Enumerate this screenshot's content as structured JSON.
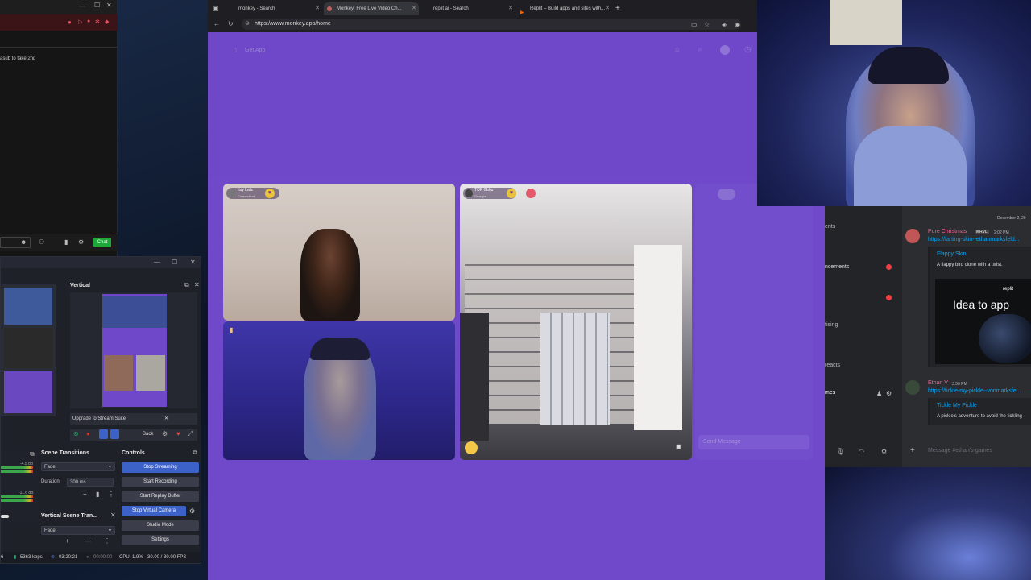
{
  "left_app": {
    "message": "asub to take 2nd",
    "chat_button": "Chat"
  },
  "obs": {
    "vertical_panel_title": "Vertical",
    "upgrade_label": "Upgrade to Stream Suite",
    "back_label": "Back",
    "scene_transitions": {
      "title": "Scene Transitions",
      "selected": "Fade",
      "duration_label": "Duration",
      "duration_value": "300 ms"
    },
    "vertical_scene_transitions": {
      "title": "Vertical Scene Tran...",
      "selected": "Fade"
    },
    "controls": {
      "title": "Controls",
      "stop_streaming": "Stop Streaming",
      "start_recording": "Start Recording",
      "start_replay_buffer": "Start Replay Buffer",
      "stop_virtual_camera": "Stop Virtual Camera",
      "studio_mode": "Studio Mode",
      "settings": "Settings"
    },
    "meter_labels": [
      "-4.5 dB",
      "-11.6 dB"
    ],
    "status": {
      "bitrate": "5363 kbps",
      "stream_time": "03:20:21",
      "record_time": "00:00:00",
      "cpu": "CPU: 1.9%",
      "fps": "30.00 / 30.00 FPS",
      "left_value": "6"
    }
  },
  "browser": {
    "tabs": [
      {
        "label": "monkey - Search"
      },
      {
        "label": "Monkey: Free Live Video Ch..."
      },
      {
        "label": "replit ai - Search"
      },
      {
        "label": "Replit – Build apps and sites with..."
      }
    ],
    "url": "https://www.monkey.app/home"
  },
  "monkey": {
    "get_app": "Get App",
    "user1": {
      "name": "Itsy Lala",
      "location": "Connecticut"
    },
    "user2": {
      "name": "TOP Goku",
      "location": "Georgia"
    },
    "send_message_placeholder": "Send Message"
  },
  "discord": {
    "date": "December 2, 20",
    "sidebar": [
      "ents",
      "ncements",
      "tising",
      "reacts",
      "mes"
    ],
    "msg1": {
      "author": "Pure Christmas",
      "tag": "MRVL",
      "time": "2:02 PM",
      "link": "https://farting-skin--ethanmarksfeld...",
      "embed_title": "Flappy Skin",
      "embed_desc": "A flappy bird clone with a twist.",
      "embed_image_brand": "replit",
      "embed_image_text": "Idea to app"
    },
    "msg2": {
      "author": "Ethan V",
      "time": "3:50 PM",
      "link": "https://tickle-my-pickle--vonmarksfe...",
      "embed_title": "Tickle My Pickle",
      "embed_desc": "A pickle's adventure to avoid the tickling"
    },
    "composer_placeholder": "Message #ethan's-games"
  }
}
